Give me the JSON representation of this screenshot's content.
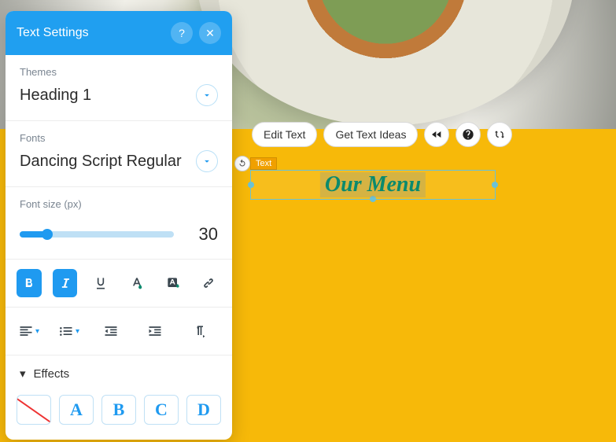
{
  "panel": {
    "title": "Text Settings",
    "themes_label": "Themes",
    "theme_value": "Heading 1",
    "fonts_label": "Fonts",
    "font_value": "Dancing Script Regular",
    "fontsize_label": "Font size (px)",
    "fontsize_value": "30",
    "effects_label": "Effects",
    "effect_options": {
      "a": "A",
      "b": "B",
      "c": "C",
      "d": "D"
    },
    "help": "?",
    "close": "✕"
  },
  "floatbar": {
    "edit_text": "Edit Text",
    "get_ideas": "Get Text Ideas"
  },
  "canvas": {
    "text_tag": "Text",
    "selected_text": "Our Menu"
  }
}
